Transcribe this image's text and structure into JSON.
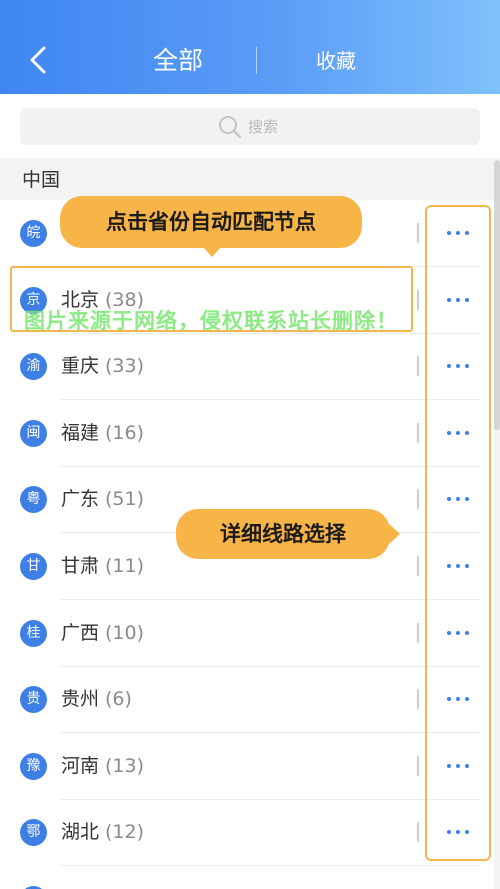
{
  "header": {
    "tab_all": "全部",
    "tab_favorites": "收藏",
    "gradient_start": "#3f86f3",
    "gradient_end": "#7fc1fb"
  },
  "search": {
    "placeholder": "搜索"
  },
  "section_title": "中国",
  "provinces": [
    {
      "badge": "皖",
      "name": "",
      "count": ""
    },
    {
      "badge": "京",
      "name": "北京",
      "count": "(38)"
    },
    {
      "badge": "渝",
      "name": "重庆",
      "count": "(33)"
    },
    {
      "badge": "闽",
      "name": "福建",
      "count": "(16)"
    },
    {
      "badge": "粤",
      "name": "广东",
      "count": "(51)"
    },
    {
      "badge": "甘",
      "name": "甘肃",
      "count": "(11)"
    },
    {
      "badge": "桂",
      "name": "广西",
      "count": "(10)"
    },
    {
      "badge": "贵",
      "name": "贵州",
      "count": "(6)"
    },
    {
      "badge": "豫",
      "name": "河南",
      "count": "(13)"
    },
    {
      "badge": "鄂",
      "name": "湖北",
      "count": "(12)"
    }
  ],
  "annotations": {
    "auto_match": "点击省份自动匹配节点",
    "route_select": "详细线路选择",
    "watermark": "图片来源于网络，侵权联系站长删除！",
    "highlight_color": "#f2b64b"
  },
  "colors": {
    "accent": "#3e7fe6",
    "callout": "#f7b447"
  }
}
